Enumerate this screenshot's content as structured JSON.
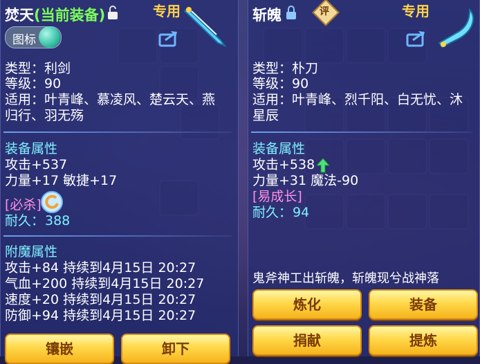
{
  "left": {
    "title_name": "焚天",
    "title_status": "(当前装备)",
    "tag_exclusive": "专用",
    "icon_toggle_label": "图标",
    "type_line": "类型：利剑",
    "level_line": "等级：90",
    "suitable_line1": "适用：叶青峰、慕凌风、楚云天、燕",
    "suitable_line2": "归行、羽无殇",
    "attr_title": "装备属性",
    "attack": "攻击+537",
    "strength_agility": "力量+17 敏捷+17",
    "skill_tag": "[必杀]",
    "durability_label": "耐久：",
    "durability_value": "388",
    "enchant_title": "附魔属性",
    "enchants": [
      "攻击+84 持续到4月15日 20:27",
      "气血+200 持续到4月15日 20:27",
      "速度+20 持续到4月15日 20:27",
      "防御+94 持续到4月15日 20:27"
    ],
    "btn_inlay": "镶嵌",
    "btn_unequip": "卸下"
  },
  "right": {
    "title_name": "斩魄",
    "rating_badge": "评",
    "tag_exclusive": "专用",
    "type_line": "类型：朴刀",
    "level_line": "等级：90",
    "suitable_line1": "适用：叶青峰、烈千阳、白无忧、沐",
    "suitable_line2": "星辰",
    "attr_title": "装备属性",
    "attack": "攻击+538",
    "strength_magic": "力量+31 魔法-90",
    "growth_tag": "[易成长]",
    "durability_label": "耐久：",
    "durability_value": "94",
    "slogan": "鬼斧神工出斩魄，斩魄现兮战神落",
    "btn_refine": "炼化",
    "btn_equip": "装备",
    "btn_donate": "捐献",
    "btn_extract": "提炼"
  },
  "colors": {
    "accent_gold": "#ffd24a",
    "value_cyan": "#7ff0ff",
    "status_green": "#7cff5a",
    "skill_pink": "#ff8fe6"
  }
}
